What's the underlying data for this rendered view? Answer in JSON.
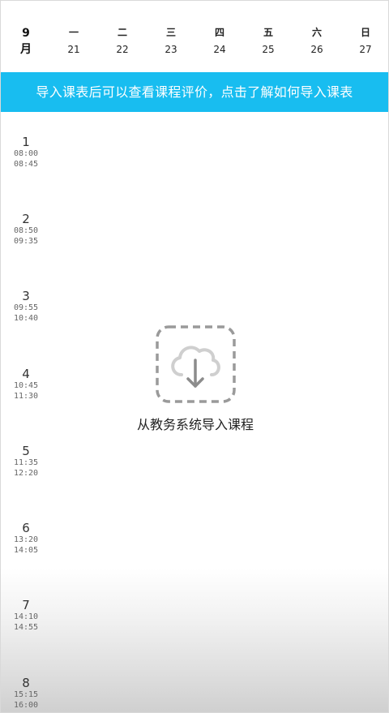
{
  "header": {
    "month": "9",
    "month_unit": "月",
    "days": [
      {
        "weekday": "一",
        "date": "21"
      },
      {
        "weekday": "二",
        "date": "22"
      },
      {
        "weekday": "三",
        "date": "23"
      },
      {
        "weekday": "四",
        "date": "24"
      },
      {
        "weekday": "五",
        "date": "25"
      },
      {
        "weekday": "六",
        "date": "26"
      },
      {
        "weekday": "日",
        "date": "27"
      }
    ]
  },
  "banner": {
    "text": "导入课表后可以查看课程评价，点击了解如何导入课表",
    "color": "#18bdf0"
  },
  "periods": [
    {
      "num": "1",
      "start": "08:00",
      "end": "08:45"
    },
    {
      "num": "2",
      "start": "08:50",
      "end": "09:35"
    },
    {
      "num": "3",
      "start": "09:55",
      "end": "10:40"
    },
    {
      "num": "4",
      "start": "10:45",
      "end": "11:30"
    },
    {
      "num": "5",
      "start": "11:35",
      "end": "12:20"
    },
    {
      "num": "6",
      "start": "13:20",
      "end": "14:05"
    },
    {
      "num": "7",
      "start": "14:10",
      "end": "14:55"
    },
    {
      "num": "8",
      "start": "15:15",
      "end": "16:00"
    }
  ],
  "empty_state": {
    "icon": "cloud-download-icon",
    "label": "从教务系统导入课程"
  }
}
